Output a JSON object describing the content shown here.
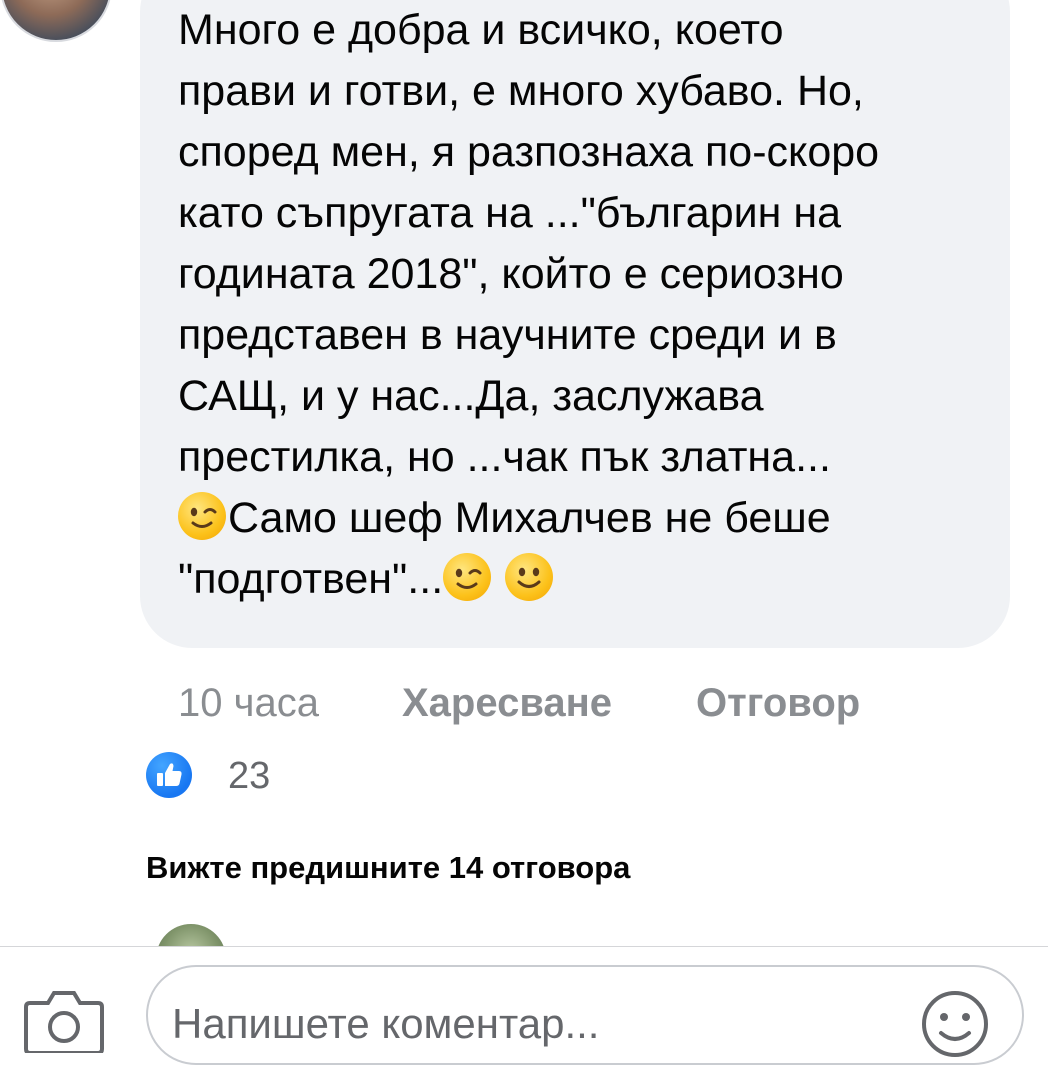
{
  "comment": {
    "lines": [
      "Много е добра и всичко, което",
      "прави и готви, е много хубаво. Но,",
      "според мен, я разпознаха по-скоро",
      "като съпругата на ...\"българин на",
      "годината 2018\", който е сериозно",
      "представен в научните среди и в",
      "САЩ, и у нас...Да, заслужава",
      "престилка, но ...чак пък златна...",
      "Само шеф Михалчев не беше",
      "\"подготвен\"..."
    ],
    "emojis": [
      "winking-face",
      "winking-face",
      "smiling-face"
    ]
  },
  "meta": {
    "time": "10 часа",
    "like_label": "Харесване",
    "reply_label": "Отговор"
  },
  "reactions": {
    "icon": "like-thumbs-up-icon",
    "count": "23"
  },
  "replies": {
    "view_previous": "Вижте предишните 14 отговора"
  },
  "composer": {
    "placeholder": "Напишете коментар...",
    "camera_icon": "camera-icon",
    "emoji_icon": "smiley-icon"
  },
  "colors": {
    "bubble": "#f0f2f5",
    "meta_text": "#8a8d91",
    "like_blue": "#1877f2"
  }
}
